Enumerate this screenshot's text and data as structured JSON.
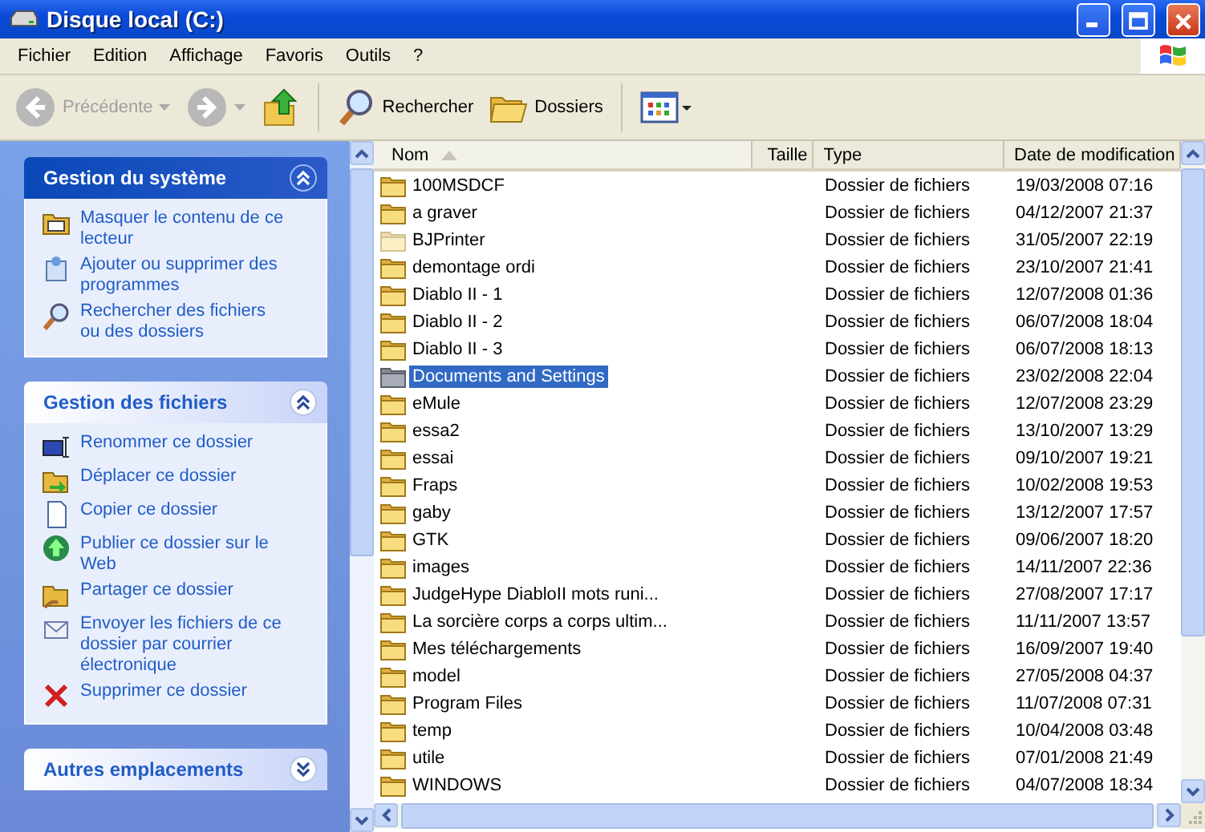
{
  "window": {
    "title": "Disque local (C:)"
  },
  "menu": [
    "Fichier",
    "Edition",
    "Affichage",
    "Favoris",
    "Outils",
    "?"
  ],
  "toolbar": [
    {
      "kind": "back",
      "label": "Précédente",
      "disabled": true
    },
    {
      "kind": "forward",
      "disabled": true
    },
    {
      "kind": "up"
    },
    {
      "kind": "search",
      "label": "Rechercher"
    },
    {
      "kind": "folders",
      "label": "Dossiers"
    },
    {
      "kind": "views"
    }
  ],
  "panels": [
    {
      "title": "Gestion du système",
      "kind": "special",
      "expanded": true,
      "items": [
        {
          "kind": "hide",
          "label": "Masquer le contenu de ce lecteur"
        },
        {
          "kind": "programs",
          "label": "Ajouter ou supprimer des programmes"
        },
        {
          "kind": "search",
          "label": "Rechercher des fichiers ou des dossiers"
        }
      ]
    },
    {
      "title": "Gestion des fichiers",
      "kind": "normal",
      "expanded": true,
      "items": [
        {
          "kind": "rename",
          "label": "Renommer ce dossier"
        },
        {
          "kind": "move",
          "label": "Déplacer ce dossier"
        },
        {
          "kind": "copy",
          "label": "Copier ce dossier"
        },
        {
          "kind": "publish",
          "label": "Publier ce dossier sur le Web"
        },
        {
          "kind": "share",
          "label": "Partager ce dossier"
        },
        {
          "kind": "email",
          "label": "Envoyer les fichiers de ce dossier par courrier électronique"
        },
        {
          "kind": "delete",
          "label": "Supprimer ce dossier"
        }
      ]
    },
    {
      "title": "Autres emplacements",
      "kind": "normal",
      "expanded": false
    }
  ],
  "table": {
    "columns": [
      {
        "label": "Nom",
        "sorted": true
      },
      {
        "label": "Taille",
        "sorted": false
      },
      {
        "label": "Type",
        "sorted": false
      },
      {
        "label": "Date de modification",
        "sorted": false
      }
    ],
    "rows": [
      {
        "name": "100MSDCF",
        "type": "Dossier de fichiers",
        "date": "19/03/2008 07:16",
        "hidden": false,
        "selected": false
      },
      {
        "name": "a graver",
        "type": "Dossier de fichiers",
        "date": "04/12/2007 21:37",
        "hidden": false,
        "selected": false
      },
      {
        "name": "BJPrinter",
        "type": "Dossier de fichiers",
        "date": "31/05/2007 22:19",
        "hidden": true,
        "selected": false
      },
      {
        "name": "demontage ordi",
        "type": "Dossier de fichiers",
        "date": "23/10/2007 21:41",
        "hidden": false,
        "selected": false
      },
      {
        "name": "Diablo II - 1",
        "type": "Dossier de fichiers",
        "date": "12/07/2008 01:36",
        "hidden": false,
        "selected": false
      },
      {
        "name": "Diablo II - 2",
        "type": "Dossier de fichiers",
        "date": "06/07/2008 18:04",
        "hidden": false,
        "selected": false
      },
      {
        "name": "Diablo II - 3",
        "type": "Dossier de fichiers",
        "date": "06/07/2008 18:13",
        "hidden": false,
        "selected": false
      },
      {
        "name": "Documents and Settings",
        "type": "Dossier de fichiers",
        "date": "23/02/2008 22:04",
        "hidden": false,
        "selected": true
      },
      {
        "name": "eMule",
        "type": "Dossier de fichiers",
        "date": "12/07/2008 23:29",
        "hidden": false,
        "selected": false
      },
      {
        "name": "essa2",
        "type": "Dossier de fichiers",
        "date": "13/10/2007 13:29",
        "hidden": false,
        "selected": false
      },
      {
        "name": "essai",
        "type": "Dossier de fichiers",
        "date": "09/10/2007 19:21",
        "hidden": false,
        "selected": false
      },
      {
        "name": "Fraps",
        "type": "Dossier de fichiers",
        "date": "10/02/2008 19:53",
        "hidden": false,
        "selected": false
      },
      {
        "name": "gaby",
        "type": "Dossier de fichiers",
        "date": "13/12/2007 17:57",
        "hidden": false,
        "selected": false
      },
      {
        "name": "GTK",
        "type": "Dossier de fichiers",
        "date": "09/06/2007 18:20",
        "hidden": false,
        "selected": false
      },
      {
        "name": "images",
        "type": "Dossier de fichiers",
        "date": "14/11/2007 22:36",
        "hidden": false,
        "selected": false
      },
      {
        "name": "JudgeHype DiabloII mots runi...",
        "type": "Dossier de fichiers",
        "date": "27/08/2007 17:17",
        "hidden": false,
        "selected": false
      },
      {
        "name": "La sorcière corps a corps ultim...",
        "type": "Dossier de fichiers",
        "date": "11/11/2007 13:57",
        "hidden": false,
        "selected": false
      },
      {
        "name": "Mes téléchargements",
        "type": "Dossier de fichiers",
        "date": "16/09/2007 19:40",
        "hidden": false,
        "selected": false
      },
      {
        "name": "model",
        "type": "Dossier de fichiers",
        "date": "27/05/2008 04:37",
        "hidden": false,
        "selected": false
      },
      {
        "name": "Program Files",
        "type": "Dossier de fichiers",
        "date": "11/07/2008 07:31",
        "hidden": false,
        "selected": false
      },
      {
        "name": "temp",
        "type": "Dossier de fichiers",
        "date": "10/04/2008 03:48",
        "hidden": false,
        "selected": false
      },
      {
        "name": "utile",
        "type": "Dossier de fichiers",
        "date": "07/01/2008 21:49",
        "hidden": false,
        "selected": false
      },
      {
        "name": "WINDOWS",
        "type": "Dossier de fichiers",
        "date": "04/07/2008 18:34",
        "hidden": false,
        "selected": false
      }
    ]
  }
}
